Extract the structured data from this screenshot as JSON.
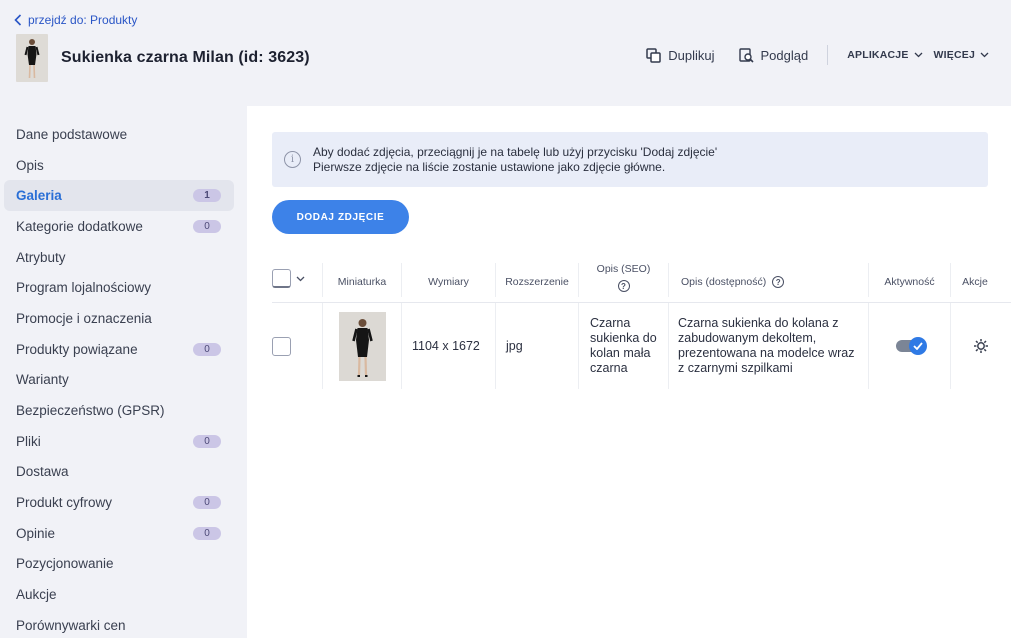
{
  "header": {
    "back_link": "przejdź do: Produkty",
    "product_title": "Sukienka czarna Milan (id: 3623)",
    "actions": {
      "duplicate": "Duplikuj",
      "preview": "Podgląd",
      "apps": "APLIKACJE",
      "more": "WIĘCEJ"
    }
  },
  "sidebar": {
    "items": [
      {
        "label": "Dane podstawowe",
        "badge": ""
      },
      {
        "label": "Opis",
        "badge": ""
      },
      {
        "label": "Galeria",
        "badge": "1"
      },
      {
        "label": "Kategorie dodatkowe",
        "badge": "0"
      },
      {
        "label": "Atrybuty",
        "badge": ""
      },
      {
        "label": "Program lojalnościowy",
        "badge": ""
      },
      {
        "label": "Promocje i oznaczenia",
        "badge": ""
      },
      {
        "label": "Produkty powiązane",
        "badge": "0"
      },
      {
        "label": "Warianty",
        "badge": ""
      },
      {
        "label": "Bezpieczeństwo (GPSR)",
        "badge": ""
      },
      {
        "label": "Pliki",
        "badge": "0"
      },
      {
        "label": "Dostawa",
        "badge": ""
      },
      {
        "label": "Produkt cyfrowy",
        "badge": "0"
      },
      {
        "label": "Opinie",
        "badge": "0"
      },
      {
        "label": "Pozycjonowanie",
        "badge": ""
      },
      {
        "label": "Aukcje",
        "badge": ""
      },
      {
        "label": "Porównywarki cen",
        "badge": ""
      }
    ],
    "active_index": 2
  },
  "info": {
    "line1": "Aby dodać zdjęcia, przeciągnij je na tabelę lub użyj przycisku 'Dodaj zdjęcie'",
    "line2": "Pierwsze zdjęcie na liście zostanie ustawione jako zdjęcie główne."
  },
  "add_button": "DODAJ ZDJĘCIE",
  "table": {
    "columns": {
      "thumbnail": "Miniaturka",
      "dimensions": "Wymiary",
      "extension": "Rozszerzenie",
      "seo_desc": "Opis (SEO)",
      "access_desc": "Opis (dostępność)",
      "active": "Aktywność",
      "actions": "Akcje"
    },
    "rows": [
      {
        "dimensions": "1104 x 1672",
        "extension": "jpg",
        "seo_desc": "Czarna sukienka do kolan mała czarna",
        "access_desc": "Czarna sukienka do kolana z zabudowanym dekoltem, prezentowana na modelce wraz z czarnymi szpilkami",
        "active": true
      }
    ]
  },
  "colors": {
    "accent": "#3d82e8",
    "active_nav": "#2a6fd6",
    "badge": "#cbc6e6"
  }
}
